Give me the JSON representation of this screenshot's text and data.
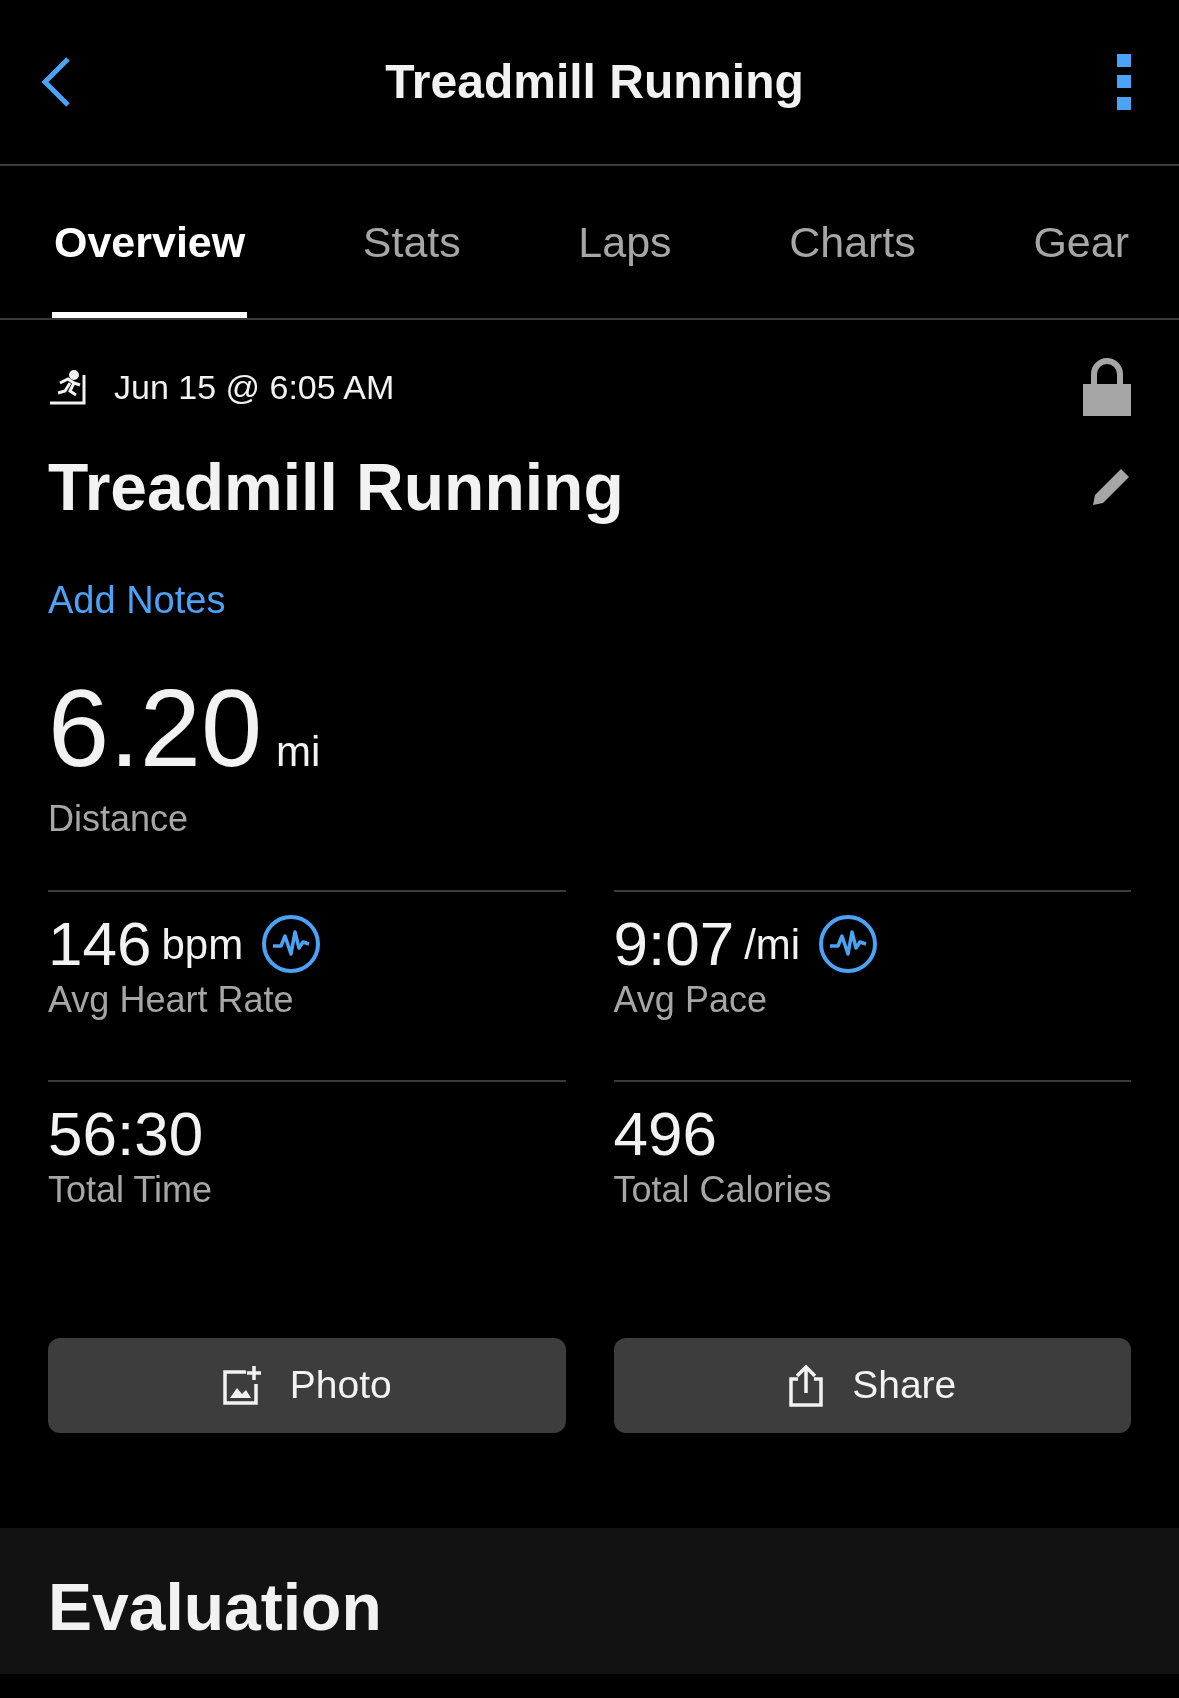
{
  "header": {
    "title": "Treadmill Running"
  },
  "tabs": [
    {
      "label": "Overview",
      "selected": true
    },
    {
      "label": "Stats",
      "selected": false
    },
    {
      "label": "Laps",
      "selected": false
    },
    {
      "label": "Charts",
      "selected": false
    },
    {
      "label": "Gear",
      "selected": false
    }
  ],
  "activity": {
    "date": "Jun 15 @ 6:05 AM",
    "name": "Treadmill Running",
    "notes_link": "Add Notes"
  },
  "distance": {
    "value": "6.20",
    "unit": "mi",
    "label": "Distance"
  },
  "metrics": [
    {
      "kind": "graph",
      "value": "146",
      "unit": "bpm",
      "label": "Avg Heart Rate"
    },
    {
      "kind": "graph",
      "value": "9:07",
      "unit": "/mi",
      "label": "Avg Pace"
    },
    {
      "kind": "plain",
      "value": "56:30",
      "label": "Total Time"
    },
    {
      "kind": "plain",
      "value": "496",
      "label": "Total Calories"
    }
  ],
  "buttons": [
    {
      "kind": "photo",
      "label": "Photo"
    },
    {
      "kind": "share",
      "label": "Share"
    }
  ],
  "evaluation": {
    "title": "Evaluation"
  }
}
